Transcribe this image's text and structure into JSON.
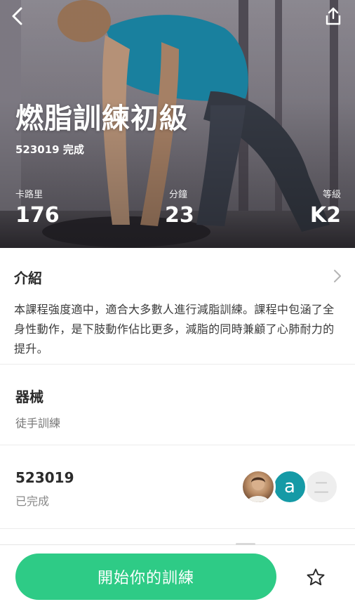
{
  "hero": {
    "title": "燃脂訓練初級",
    "completed_text": "523019 完成",
    "stats": {
      "calories": {
        "label": "卡路里",
        "value": "176"
      },
      "minutes": {
        "label": "分鐘",
        "value": "23"
      },
      "level": {
        "label": "等級",
        "value": "K2"
      }
    },
    "icons": {
      "back": "back-arrow-icon",
      "share": "share-icon"
    }
  },
  "intro": {
    "heading": "介紹",
    "body": "本課程強度適中，適合大多數人進行減脂訓練。課程中包涵了全身性動作，是下肢動作佔比更多，減脂的同時兼顧了心肺耐力的提升。"
  },
  "equipment": {
    "heading": "器械",
    "value": "徒手訓練"
  },
  "participants": {
    "count": "523019",
    "status": "已完成",
    "avatars": [
      {
        "type": "photo"
      },
      {
        "type": "letter",
        "text": "a",
        "color": "#159aa6"
      },
      {
        "type": "letter",
        "text": "二",
        "color": "#eeeeee"
      }
    ]
  },
  "actions": {
    "start_label": "開始你的訓練",
    "favorite_icon": "star-icon",
    "accent": "#2ecb86"
  }
}
